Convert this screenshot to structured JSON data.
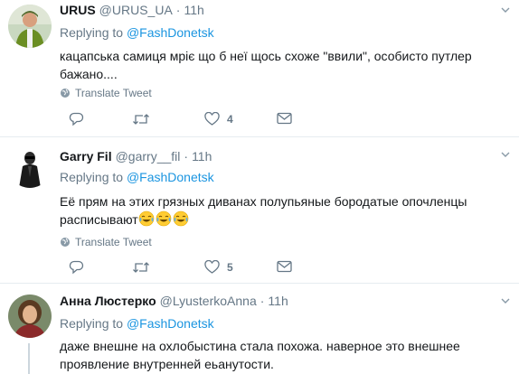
{
  "tweets": [
    {
      "name": "URUS",
      "handle": "@URUS_UA",
      "dot": "·",
      "time": "11h",
      "replying_prefix": "Replying to",
      "replying_to": "@FashDonetsk",
      "text": "кацапська самиця мріє що б неї щось схоже \"ввили\", особисто путлер бажано....",
      "translate_label": "Translate Tweet",
      "reply_count": "",
      "retweet_count": "",
      "like_count": "4",
      "avatar_icon": "avatar-man-green-hoodie"
    },
    {
      "name": "Garry Fil",
      "handle": "@garry__fil",
      "dot": "·",
      "time": "11h",
      "replying_prefix": "Replying to",
      "replying_to": "@FashDonetsk",
      "text": "Её прям на этих грязных диванах полупьяные бородатые опочленцы расписывают",
      "emojis": [
        "face-with-tears-of-joy",
        "face-with-tears-of-joy",
        "face-with-tears-of-joy"
      ],
      "translate_label": "Translate Tweet",
      "reply_count": "",
      "retweet_count": "",
      "like_count": "5",
      "avatar_icon": "avatar-dark-figure"
    },
    {
      "name": "Анна Люстерко",
      "handle": "@LyusterkoAnna",
      "dot": "·",
      "time": "11h",
      "replying_prefix": "Replying to",
      "replying_to": "@FashDonetsk",
      "text": "даже внешне на охлобыстина стала похожа. наверное это внешнее проявление внутренней еьанутости.",
      "avatar_icon": "avatar-woman-portrait"
    }
  ],
  "colors": {
    "link": "#1b95e0",
    "secondary": "#657786",
    "text": "#14171a",
    "divider": "#e6ecf0"
  }
}
